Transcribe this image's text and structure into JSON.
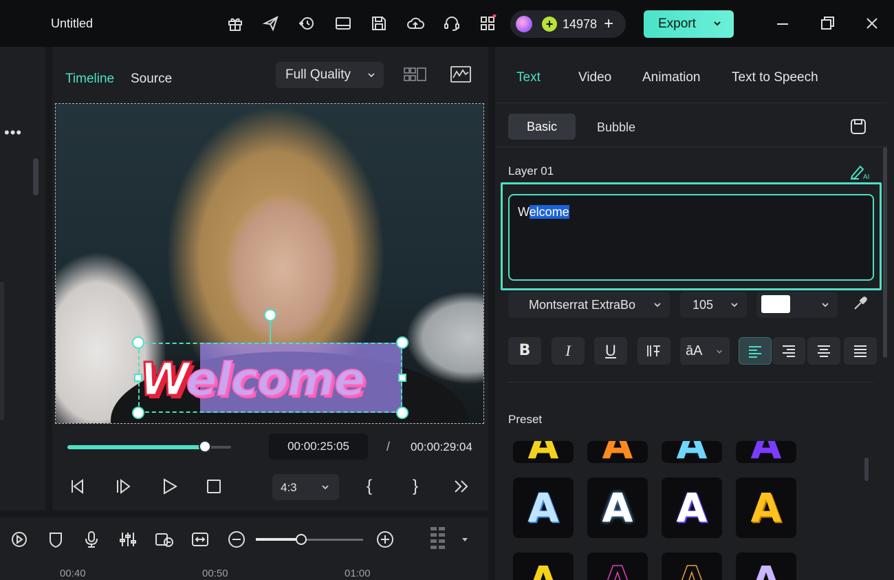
{
  "app": {
    "title": "Untitled"
  },
  "toolbar": {
    "icons": [
      "gift-icon",
      "send-icon",
      "cloud-sync-icon",
      "layout-icon",
      "save-icon",
      "cloud-upload-icon",
      "headset-icon",
      "apps-grid-icon"
    ],
    "credits": "14978",
    "credits_plus": "+",
    "export_label": "Export"
  },
  "player": {
    "tab_timeline": "Timeline",
    "tab_source": "Source",
    "quality": "Full Quality",
    "caption_first": "W",
    "caption_rest": "elcome",
    "progress": 0.84,
    "current_time": "00:00:25:05",
    "time_separator": "/",
    "total_time": "00:00:29:04",
    "ratio": "4:3",
    "open_brace": "{",
    "close_brace": "}"
  },
  "timeline": {
    "zoom_level": 0.42,
    "ticks": [
      "00:40",
      "00:50",
      "01:00"
    ]
  },
  "props": {
    "tabs": [
      "Text",
      "Video",
      "Animation",
      "Text to Speech"
    ],
    "sub_tabs": [
      "Basic",
      "Bubble"
    ],
    "layer_label": "Layer 01",
    "text_plain": "W",
    "text_selected": "elcome",
    "font": "Montserrat ExtraBo",
    "size": "105",
    "color": "#ffffff",
    "format_buttons": {
      "bold": "B",
      "italic": "I",
      "underline": "U",
      "case": "āA"
    },
    "preset_label": "Preset",
    "accent_color": "#4de0c4"
  }
}
